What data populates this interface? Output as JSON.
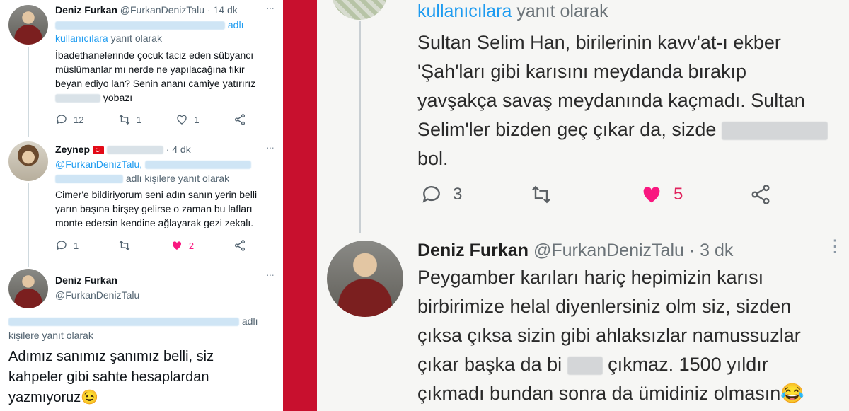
{
  "left": {
    "tweet1": {
      "name": "Deniz Furkan",
      "handle": "@FurkanDenizTalu",
      "time": "· 14 dk",
      "reply_suffix": "adlı",
      "reply_line2_link": "kullanıcılara",
      "reply_line2_rest": " yanıt olarak",
      "body_lines": [
        "İbadethanelerinde çocuk taciz eden sübyancı",
        "müslümanlar mı nerde ne yapılacağına fikir",
        "beyan ediyo lan? Senin ananı camiye yatırırız"
      ],
      "body_last": "yobazı",
      "replies": "12",
      "retweets": "1",
      "likes": "1"
    },
    "tweet2": {
      "name": "Zeynep",
      "time": "· 4 dk",
      "reply_handle": "@FurkanDenizTalu,",
      "reply_rest": " adlı kişilere yanıt olarak",
      "body_lines": [
        "Cimer'e bildiriyorum seni adın sanın yerin belli",
        "yarın başına birşey gelirse o zaman bu lafları",
        "monte edersin kendine ağlayarak gezi zekalı."
      ],
      "replies": "1",
      "likes": "2"
    },
    "tweet3": {
      "name": "Deniz Furkan",
      "handle": "@FurkanDenizTalu",
      "reply_suffix": "adlı",
      "reply_line2": "kişilere yanıt olarak",
      "body_lines": [
        "Adımız sanımız şanımız belli, siz",
        "kahpeler gibi sahte hesaplardan"
      ],
      "body_last": "yazmıyoruz",
      "emoji": "😉"
    }
  },
  "right": {
    "top_reply_link": "kullanıcılara",
    "top_reply_rest": " yanıt olarak",
    "tweet1_lines": [
      "Sultan Selim Han, birilerinin kavv'at-ı ekber",
      "'Şah'ları gibi karısını meydanda bırakıp",
      "yavşakça savaş meydanında kaçmadı. Sultan",
      "Selim'ler bizden geç çıkar da, sizde"
    ],
    "tweet1_last": "bol.",
    "replies": "3",
    "likes": "5",
    "tweet2": {
      "name": "Deniz Furkan",
      "handle": "@FurkanDenizTalu",
      "time": "· 3 dk",
      "lines": [
        "Peygamber karıları hariç hepimizin karısı",
        "birbirimize helal diyenlersiniz olm siz, sizden",
        "çıksa çıksa sizin gibi ahlaksızlar namussuzlar"
      ],
      "line4_a": "çıkar başka da bi",
      "line4_b": "çıkmaz. 1500 yıldır",
      "line5": "çıkmadı bundan sonra da ümidiniz olmasın",
      "emoji": "😂"
    }
  },
  "colors": {
    "divider": "#c8102e",
    "link": "#1d9bf0",
    "like": "#f91880"
  }
}
